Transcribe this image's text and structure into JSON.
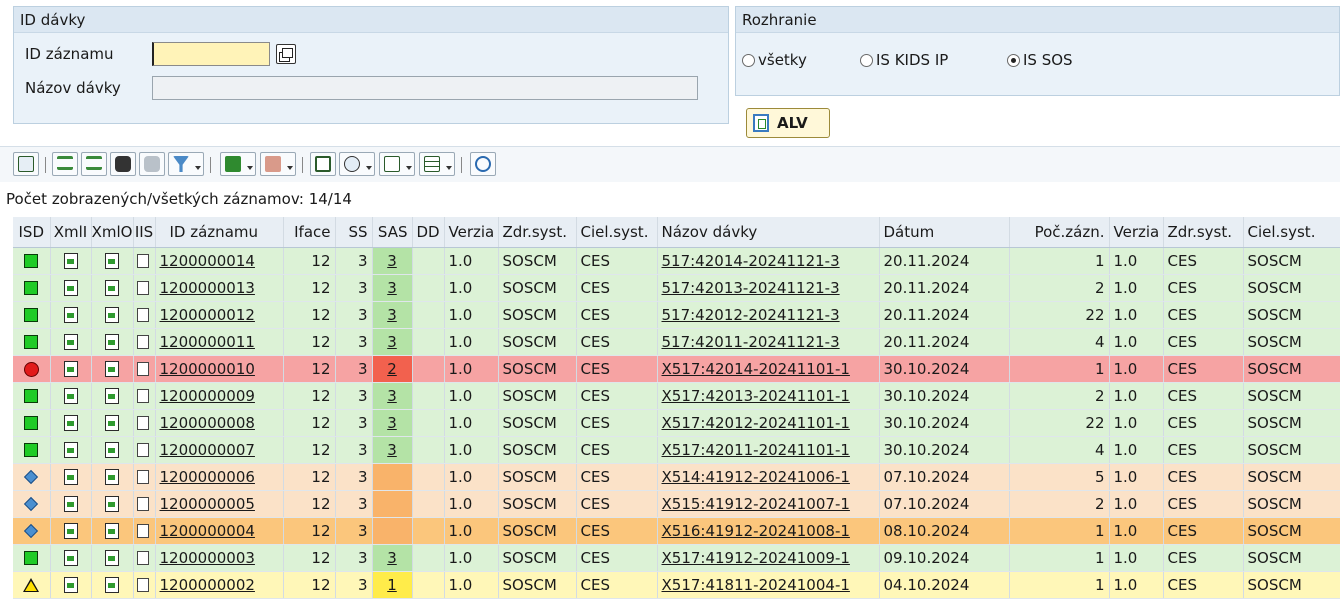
{
  "batch_group": {
    "title": "ID dávky",
    "record_id_label": "ID záznamu",
    "record_id_value": "",
    "batch_name_label": "Názov dávky",
    "batch_name_value": ""
  },
  "interface_group": {
    "title": "Rozhranie",
    "options": [
      "všetky",
      "IS KIDS IP",
      "IS SOS"
    ],
    "selected": "IS SOS"
  },
  "alv_button": "ALV",
  "toolbar_icons": [
    "details-icon",
    "sort-ascending-icon",
    "sort-descending-icon",
    "find-icon",
    "find-next-icon",
    "filter-icon",
    "total-icon",
    "subtotal-icon",
    "print-icon",
    "views-icon",
    "export-icon",
    "layout-icon",
    "refresh-icon"
  ],
  "count_text": "Počet zobrazených/všetkých záznamov: 14/14",
  "columns": [
    "ISD",
    "XmlI",
    "XmlO",
    "IIS",
    "ID záznamu",
    "Iface",
    "SS",
    "SAS",
    "DD",
    "Verzia",
    "Zdr.syst.",
    "Ciel.syst.",
    "Názov dávky",
    "Dátum",
    "Poč.zázn.",
    "Verzia",
    "Zdr.syst.",
    "Ciel.syst."
  ],
  "rows": [
    {
      "status": "ok",
      "tone": "green",
      "id": "1200000014",
      "iface": "12",
      "ss": "3",
      "sas": "3",
      "dd": "",
      "ver": "1.0",
      "src": "SOSCM",
      "tgt": "CES",
      "name": "517:42014-20241121-3",
      "date": "20.11.2024",
      "cnt": "1",
      "ver2": "1.0",
      "src2": "CES",
      "tgt2": "SOSCM"
    },
    {
      "status": "ok",
      "tone": "green",
      "id": "1200000013",
      "iface": "12",
      "ss": "3",
      "sas": "3",
      "dd": "",
      "ver": "1.0",
      "src": "SOSCM",
      "tgt": "CES",
      "name": "517:42013-20241121-3",
      "date": "20.11.2024",
      "cnt": "2",
      "ver2": "1.0",
      "src2": "CES",
      "tgt2": "SOSCM"
    },
    {
      "status": "ok",
      "tone": "green",
      "id": "1200000012",
      "iface": "12",
      "ss": "3",
      "sas": "3",
      "dd": "",
      "ver": "1.0",
      "src": "SOSCM",
      "tgt": "CES",
      "name": "517:42012-20241121-3",
      "date": "20.11.2024",
      "cnt": "22",
      "ver2": "1.0",
      "src2": "CES",
      "tgt2": "SOSCM"
    },
    {
      "status": "ok",
      "tone": "green",
      "id": "1200000011",
      "iface": "12",
      "ss": "3",
      "sas": "3",
      "dd": "",
      "ver": "1.0",
      "src": "SOSCM",
      "tgt": "CES",
      "name": "517:42011-20241121-3",
      "date": "20.11.2024",
      "cnt": "4",
      "ver2": "1.0",
      "src2": "CES",
      "tgt2": "SOSCM"
    },
    {
      "status": "error",
      "tone": "red",
      "id": "1200000010",
      "iface": "12",
      "ss": "3",
      "sas": "2",
      "dd": "",
      "ver": "1.0",
      "src": "SOSCM",
      "tgt": "CES",
      "name": "X517:42014-20241101-1",
      "date": "30.10.2024",
      "cnt": "1",
      "ver2": "1.0",
      "src2": "CES",
      "tgt2": "SOSCM"
    },
    {
      "status": "ok",
      "tone": "green",
      "id": "1200000009",
      "iface": "12",
      "ss": "3",
      "sas": "3",
      "dd": "",
      "ver": "1.0",
      "src": "SOSCM",
      "tgt": "CES",
      "name": "X517:42013-20241101-1",
      "date": "30.10.2024",
      "cnt": "2",
      "ver2": "1.0",
      "src2": "CES",
      "tgt2": "SOSCM"
    },
    {
      "status": "ok",
      "tone": "green",
      "id": "1200000008",
      "iface": "12",
      "ss": "3",
      "sas": "3",
      "dd": "",
      "ver": "1.0",
      "src": "SOSCM",
      "tgt": "CES",
      "name": "X517:42012-20241101-1",
      "date": "30.10.2024",
      "cnt": "22",
      "ver2": "1.0",
      "src2": "CES",
      "tgt2": "SOSCM"
    },
    {
      "status": "ok",
      "tone": "green",
      "id": "1200000007",
      "iface": "12",
      "ss": "3",
      "sas": "3",
      "dd": "",
      "ver": "1.0",
      "src": "SOSCM",
      "tgt": "CES",
      "name": "X517:42011-20241101-1",
      "date": "30.10.2024",
      "cnt": "4",
      "ver2": "1.0",
      "src2": "CES",
      "tgt2": "SOSCM"
    },
    {
      "status": "pending",
      "tone": "peach",
      "id": "1200000006",
      "iface": "12",
      "ss": "3",
      "sas": "",
      "dd": "",
      "ver": "1.0",
      "src": "SOSCM",
      "tgt": "CES",
      "name": "X514:41912-20241006-1",
      "date": "07.10.2024",
      "cnt": "5",
      "ver2": "1.0",
      "src2": "CES",
      "tgt2": "SOSCM"
    },
    {
      "status": "pending",
      "tone": "peach",
      "id": "1200000005",
      "iface": "12",
      "ss": "3",
      "sas": "",
      "dd": "",
      "ver": "1.0",
      "src": "SOSCM",
      "tgt": "CES",
      "name": "X515:41912-20241007-1",
      "date": "07.10.2024",
      "cnt": "2",
      "ver2": "1.0",
      "src2": "CES",
      "tgt2": "SOSCM"
    },
    {
      "status": "pending",
      "tone": "orange",
      "id": "1200000004",
      "iface": "12",
      "ss": "3",
      "sas": "",
      "dd": "",
      "ver": "1.0",
      "src": "SOSCM",
      "tgt": "CES",
      "name": "X516:41912-20241008-1",
      "date": "08.10.2024",
      "cnt": "1",
      "ver2": "1.0",
      "src2": "CES",
      "tgt2": "SOSCM"
    },
    {
      "status": "ok",
      "tone": "green",
      "id": "1200000003",
      "iface": "12",
      "ss": "3",
      "sas": "3",
      "dd": "",
      "ver": "1.0",
      "src": "SOSCM",
      "tgt": "CES",
      "name": "X517:41912-20241009-1",
      "date": "09.10.2024",
      "cnt": "1",
      "ver2": "1.0",
      "src2": "CES",
      "tgt2": "SOSCM"
    },
    {
      "status": "warning",
      "tone": "yellow",
      "id": "1200000002",
      "iface": "12",
      "ss": "3",
      "sas": "1",
      "dd": "",
      "ver": "1.0",
      "src": "SOSCM",
      "tgt": "CES",
      "name": "X517:41811-20241004-1",
      "date": "04.10.2024",
      "cnt": "1",
      "ver2": "1.0",
      "src2": "CES",
      "tgt2": "SOSCM"
    }
  ]
}
